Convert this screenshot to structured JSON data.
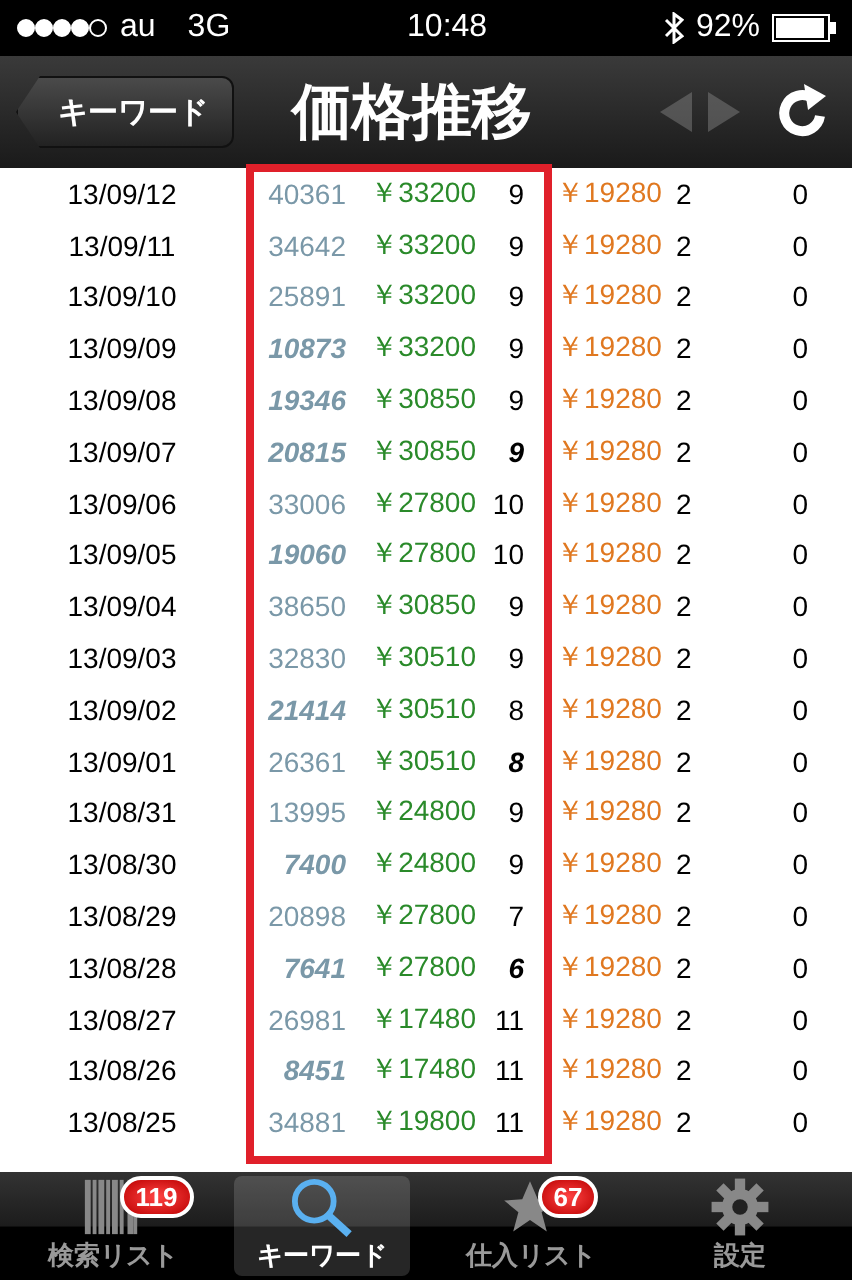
{
  "status_bar": {
    "carrier": "au",
    "network": "3G",
    "time": "10:48",
    "battery": "92%"
  },
  "nav_bar": {
    "back": "キーワード",
    "title": "価格推移",
    "prev_disabled": true,
    "next_disabled": true
  },
  "table": {
    "highlight": true,
    "rows": [
      {
        "date": "13/09/12",
        "count": "40361",
        "count_emphasized": false,
        "price": "￥33200",
        "rank": "9",
        "rank_emphasized": false,
        "used_price": "￥19280",
        "used_count": "2",
        "column_7": "0"
      },
      {
        "date": "13/09/11",
        "count": "34642",
        "count_emphasized": false,
        "price": "￥33200",
        "rank": "9",
        "rank_emphasized": false,
        "used_price": "￥19280",
        "used_count": "2",
        "column_7": "0"
      },
      {
        "date": "13/09/10",
        "count": "25891",
        "count_emphasized": false,
        "price": "￥33200",
        "rank": "9",
        "rank_emphasized": false,
        "used_price": "￥19280",
        "used_count": "2",
        "column_7": "0"
      },
      {
        "date": "13/09/09",
        "count": "10873",
        "count_emphasized": true,
        "price": "￥33200",
        "rank": "9",
        "rank_emphasized": false,
        "used_price": "￥19280",
        "used_count": "2",
        "column_7": "0"
      },
      {
        "date": "13/09/08",
        "count": "19346",
        "count_emphasized": true,
        "price": "￥30850",
        "rank": "9",
        "rank_emphasized": false,
        "used_price": "￥19280",
        "used_count": "2",
        "column_7": "0"
      },
      {
        "date": "13/09/07",
        "count": "20815",
        "count_emphasized": true,
        "price": "￥30850",
        "rank": "9",
        "rank_emphasized": true,
        "used_price": "￥19280",
        "used_count": "2",
        "column_7": "0"
      },
      {
        "date": "13/09/06",
        "count": "33006",
        "count_emphasized": false,
        "price": "￥27800",
        "rank": "10",
        "rank_emphasized": false,
        "used_price": "￥19280",
        "used_count": "2",
        "column_7": "0"
      },
      {
        "date": "13/09/05",
        "count": "19060",
        "count_emphasized": true,
        "price": "￥27800",
        "rank": "10",
        "rank_emphasized": false,
        "used_price": "￥19280",
        "used_count": "2",
        "column_7": "0"
      },
      {
        "date": "13/09/04",
        "count": "38650",
        "count_emphasized": false,
        "price": "￥30850",
        "rank": "9",
        "rank_emphasized": false,
        "used_price": "￥19280",
        "used_count": "2",
        "column_7": "0"
      },
      {
        "date": "13/09/03",
        "count": "32830",
        "count_emphasized": false,
        "price": "￥30510",
        "rank": "9",
        "rank_emphasized": false,
        "used_price": "￥19280",
        "used_count": "2",
        "column_7": "0"
      },
      {
        "date": "13/09/02",
        "count": "21414",
        "count_emphasized": true,
        "price": "￥30510",
        "rank": "8",
        "rank_emphasized": false,
        "used_price": "￥19280",
        "used_count": "2",
        "column_7": "0"
      },
      {
        "date": "13/09/01",
        "count": "26361",
        "count_emphasized": false,
        "price": "￥30510",
        "rank": "8",
        "rank_emphasized": true,
        "used_price": "￥19280",
        "used_count": "2",
        "column_7": "0"
      },
      {
        "date": "13/08/31",
        "count": "13995",
        "count_emphasized": false,
        "price": "￥24800",
        "rank": "9",
        "rank_emphasized": false,
        "used_price": "￥19280",
        "used_count": "2",
        "column_7": "0"
      },
      {
        "date": "13/08/30",
        "count": "7400",
        "count_emphasized": true,
        "price": "￥24800",
        "rank": "9",
        "rank_emphasized": false,
        "used_price": "￥19280",
        "used_count": "2",
        "column_7": "0"
      },
      {
        "date": "13/08/29",
        "count": "20898",
        "count_emphasized": false,
        "price": "￥27800",
        "rank": "7",
        "rank_emphasized": false,
        "used_price": "￥19280",
        "used_count": "2",
        "column_7": "0"
      },
      {
        "date": "13/08/28",
        "count": "7641",
        "count_emphasized": true,
        "price": "￥27800",
        "rank": "6",
        "rank_emphasized": true,
        "used_price": "￥19280",
        "used_count": "2",
        "column_7": "0"
      },
      {
        "date": "13/08/27",
        "count": "26981",
        "count_emphasized": false,
        "price": "￥17480",
        "rank": "11",
        "rank_emphasized": false,
        "used_price": "￥19280",
        "used_count": "2",
        "column_7": "0"
      },
      {
        "date": "13/08/26",
        "count": "8451",
        "count_emphasized": true,
        "price": "￥17480",
        "rank": "11",
        "rank_emphasized": false,
        "used_price": "￥19280",
        "used_count": "2",
        "column_7": "0"
      },
      {
        "date": "13/08/25",
        "count": "34881",
        "count_emphasized": false,
        "price": "￥19800",
        "rank": "11",
        "rank_emphasized": false,
        "used_price": "￥19280",
        "used_count": "2",
        "column_7": "0"
      }
    ]
  },
  "tab_bar": [
    {
      "kind": "barcode",
      "label": "検索リスト",
      "badge": "119",
      "selected": false
    },
    {
      "kind": "search",
      "label": "キーワード",
      "selected": true
    },
    {
      "kind": "star",
      "label": "仕入リスト",
      "badge": "67",
      "selected": false
    },
    {
      "kind": "gear",
      "label": "設定",
      "selected": false
    }
  ]
}
